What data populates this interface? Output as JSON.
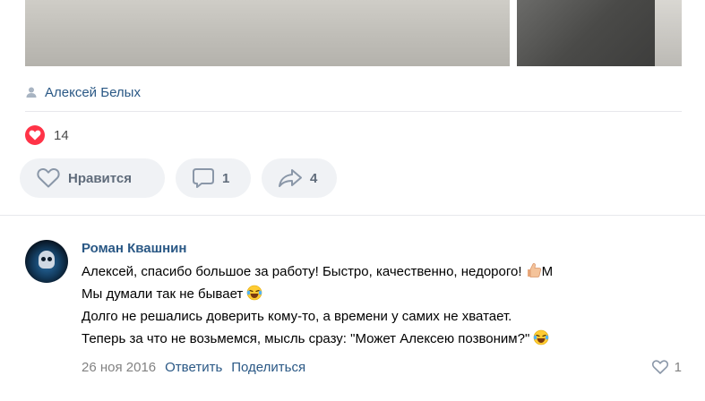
{
  "post": {
    "author_name": "Алексей Белых",
    "likes_count": "14",
    "buttons": {
      "like_label": "Нравится",
      "comments_count": "1",
      "shares_count": "4"
    }
  },
  "comment": {
    "author": "Роман Квашнин",
    "lines": [
      "Алексей, спасибо большое за работу! Быстро, качественно, недорого! ",
      "Мы думали так не бывает ",
      "Долго не решались доверить кому-то, а времени у самих не хватает.",
      "Теперь за что не возьмемся, мысль сразу: \"Может Алексею позвоним?\" "
    ],
    "line1_tail": "М",
    "date": "26 ноя 2016",
    "reply_label": "Ответить",
    "share_label": "Поделиться",
    "like_count": "1"
  },
  "colors": {
    "link": "#2a5885",
    "heart": "#ff3347",
    "button_bg": "#f0f2f5",
    "muted": "#828282"
  },
  "icons": {
    "author": "person-icon",
    "likes": "heart-filled-icon",
    "like_button": "heart-outline-icon",
    "comment_button": "comment-icon",
    "share_button": "share-arrow-icon",
    "comment_like": "heart-outline-icon",
    "emoji_1": "thumbs-up-emoji",
    "emoji_2": "laughing-tears-emoji",
    "emoji_3": "laughing-tears-emoji"
  }
}
